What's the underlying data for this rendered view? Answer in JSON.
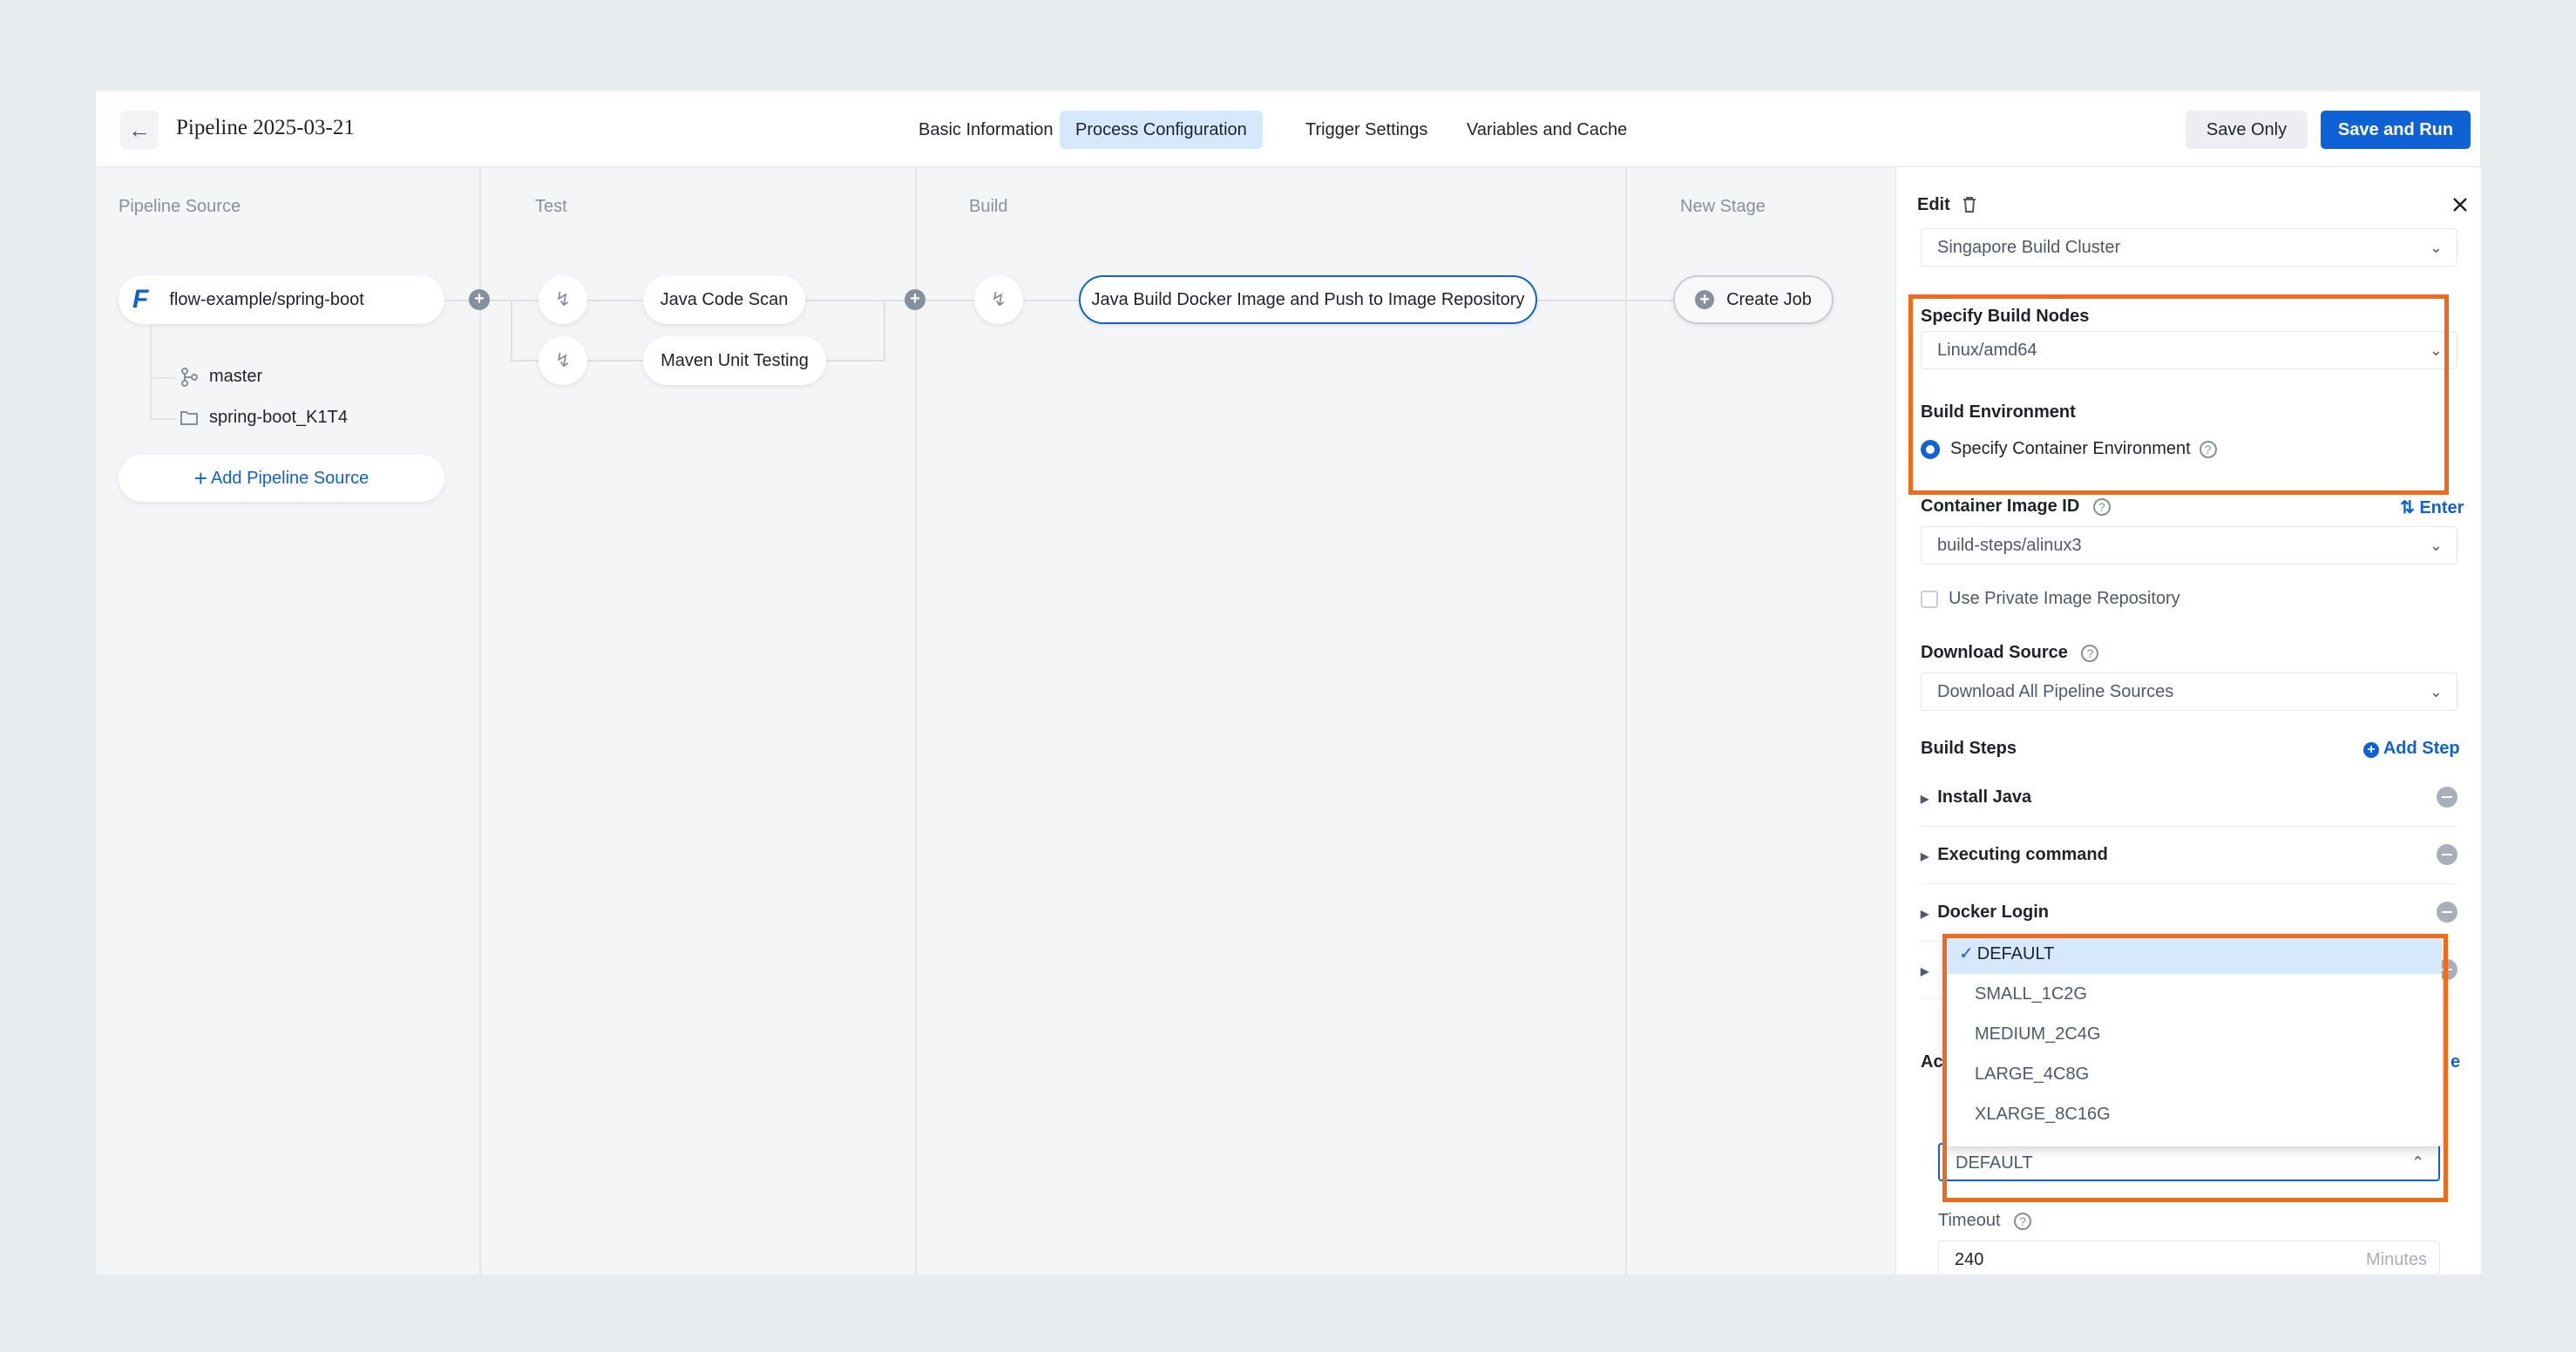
{
  "header": {
    "title": "Pipeline 2025-03-21",
    "tabs": [
      "Basic Information",
      "Process Configuration",
      "Trigger Settings",
      "Variables and Cache"
    ],
    "active_tab": "Process Configuration",
    "save_only": "Save Only",
    "save_and_run": "Save and Run"
  },
  "canvas": {
    "columns": {
      "source": "Pipeline Source",
      "test": "Test",
      "build": "Build",
      "new_stage": "New Stage"
    },
    "source": {
      "repo": "flow-example/spring-boot",
      "branch": "master",
      "folder": "spring-boot_K1T4",
      "add_source": "Add Pipeline Source"
    },
    "test_jobs": [
      "Java Code Scan",
      "Maven Unit Testing"
    ],
    "build_job": "Java Build Docker Image and Push to Image Repository",
    "create_job": "Create Job"
  },
  "panel": {
    "header": "Edit",
    "cluster": "Singapore Build Cluster",
    "build_nodes_label": "Specify Build Nodes",
    "build_nodes_value": "Linux/amd64",
    "build_env_label": "Build Environment",
    "build_env_option": "Specify Container Environment",
    "image_id_label": "Container Image ID",
    "enter_link": "Enter",
    "image_id_value": "build-steps/alinux3",
    "private_repo": "Use Private Image Repository",
    "download_label": "Download Source",
    "download_value": "Download All Pipeline Sources",
    "steps_label": "Build Steps",
    "add_step": "Add Step",
    "steps": [
      "Install Java",
      "Executing command",
      "Docker Login"
    ],
    "hidden_label_prefix": "Ac",
    "hidden_link_suffix": "e",
    "spec_value": "DEFAULT",
    "timeout_label": "Timeout",
    "timeout_value": "240",
    "timeout_unit": "Minutes"
  },
  "dropdown": {
    "options": [
      "DEFAULT",
      "SMALL_1C2G",
      "MEDIUM_2C4G",
      "LARGE_4C8G",
      "XLARGE_8C16G"
    ],
    "selected": "DEFAULT"
  },
  "colors": {
    "primary": "#0f62d6",
    "highlight": "#ef6a1b",
    "active_tab_bg": "#d6e8fc"
  }
}
